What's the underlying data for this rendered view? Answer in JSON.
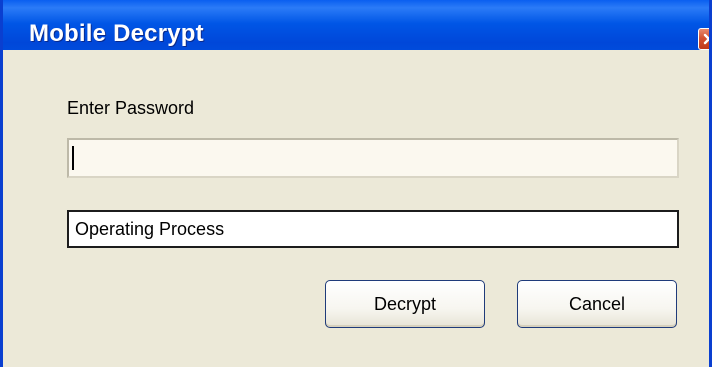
{
  "window": {
    "title": "Mobile Decrypt",
    "close_icon": "close-icon"
  },
  "form": {
    "password_label": "Enter Password",
    "password_value": "",
    "status_text": "Operating Process"
  },
  "buttons": {
    "decrypt_label": "Decrypt",
    "cancel_label": "Cancel"
  },
  "colors": {
    "titlebar": "#0054e3",
    "close_button": "#d45232",
    "dialog_background": "#ece9d8",
    "input_background": "#fbf8ef",
    "button_border": "#1f3b7a"
  }
}
